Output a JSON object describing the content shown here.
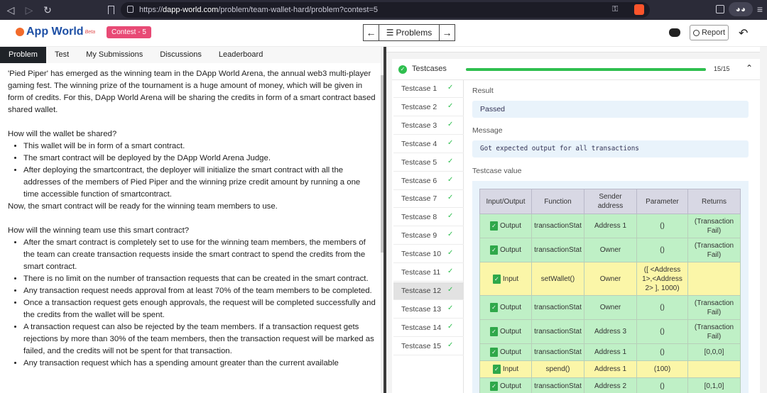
{
  "browser": {
    "url_scheme": "https://",
    "url_host": "dapp-world.com",
    "url_path": "/problem/team-wallet-hard/problem?contest=5"
  },
  "header": {
    "logo_text": "App World",
    "logo_beta": "Beta",
    "contest_badge": "Contest - 5",
    "problems_label": "Problems",
    "report_label": "Report"
  },
  "tabs": [
    "Problem",
    "Test",
    "My Submissions",
    "Discussions",
    "Leaderboard"
  ],
  "problem": {
    "intro": "'Pied Piper' has emerged as the winning team in the DApp World Arena, the annual web3 multi-player gaming fest. The winning prize of the tournament is a huge amount of money, which will be given in form of credits. For this, DApp World Arena will be sharing the credits in form of a smart contract based shared wallet.",
    "q1": "How will the wallet be shared?",
    "bullets1": [
      "This wallet will be in form of a smart contract.",
      "The smart contract will be deployed by the DApp World Arena Judge.",
      "After deploying the smartcontract, the deployer will initialize the smart contract with all the addresses of the members of Pied Piper and the winning prize credit amount by running a one time accessible function of smartcontract."
    ],
    "after1": "Now, the smart contract will be ready for the winning team members to use.",
    "q2": "How will the winning team use this smart contract?",
    "bullets2": [
      "After the smart contract is completely set to use for the winning team members, the members of the team can create transaction requests inside the smart contract to spend the credits from the smart contract.",
      "There is no limit on the number of transaction requests that can be created in the smart contract.",
      "Any transaction request needs approval from at least 70% of the team members to be completed.",
      "Once a transaction request gets enough approvals, the request will be completed successfully and the credits from the wallet will be spent.",
      "A transaction request can also be rejected by the team members. If a transaction request gets rejections by more than 30% of the team members, then the transaction request will be marked as failed, and the credits will not be spent for that transaction.",
      "Any transaction request which has a spending amount greater than the current available"
    ]
  },
  "testcases": {
    "title": "Testcases",
    "count_label": "15/15",
    "progress": 1.0,
    "items": [
      "Testcase 1",
      "Testcase 2",
      "Testcase 3",
      "Testcase 4",
      "Testcase 5",
      "Testcase 6",
      "Testcase 7",
      "Testcase 8",
      "Testcase 9",
      "Testcase 10",
      "Testcase 11",
      "Testcase 12",
      "Testcase 13",
      "Testcase 14",
      "Testcase 15"
    ],
    "selected_index": 11
  },
  "detail": {
    "result_label": "Result",
    "result_value": "Passed",
    "message_label": "Message",
    "message_value": "Got expected output for all transactions",
    "value_label": "Testcase value"
  },
  "table": {
    "headers": [
      "Input/Output",
      "Function",
      "Sender address",
      "Parameter",
      "Returns"
    ],
    "rows": [
      {
        "type": "Output",
        "function": "transactionStat",
        "sender": "Address 1",
        "parameter": "()",
        "returns": "(Transaction Fail)"
      },
      {
        "type": "Output",
        "function": "transactionStat",
        "sender": "Owner",
        "parameter": "()",
        "returns": "(Transaction Fail)"
      },
      {
        "type": "Input",
        "function": "setWallet()",
        "sender": "Owner",
        "parameter": "([ <Address 1>,<Address 2> ], 1000)",
        "returns": ""
      },
      {
        "type": "Output",
        "function": "transactionStat",
        "sender": "Owner",
        "parameter": "()",
        "returns": "(Transaction Fail)"
      },
      {
        "type": "Output",
        "function": "transactionStat",
        "sender": "Address 3",
        "parameter": "()",
        "returns": "(Transaction Fail)"
      },
      {
        "type": "Output",
        "function": "transactionStat",
        "sender": "Address 1",
        "parameter": "()",
        "returns": "[0,0,0]"
      },
      {
        "type": "Input",
        "function": "spend()",
        "sender": "Address 1",
        "parameter": "(100)",
        "returns": ""
      },
      {
        "type": "Output",
        "function": "transactionStat",
        "sender": "Address 2",
        "parameter": "()",
        "returns": "[0,1,0]"
      }
    ]
  },
  "colors": {
    "accent_green": "#2fbf4f",
    "contest_pink": "#e84a75",
    "output_row": "#bff0c6",
    "input_row": "#fbf6a8",
    "value_box": "#e9f3fb"
  },
  "icons": [
    "back-icon",
    "forward-icon",
    "reload-icon",
    "bookmark-icon",
    "lock-icon",
    "key-icon",
    "brave-icon",
    "sidebar-icon",
    "arrow-left-icon",
    "list-icon",
    "arrow-right-icon",
    "discord-icon",
    "info-icon",
    "undo-icon",
    "check-circle-icon",
    "chevron-up-icon",
    "check-icon",
    "file-icon"
  ]
}
